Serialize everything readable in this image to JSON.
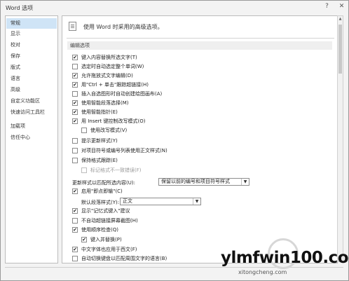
{
  "window": {
    "title": "Word 选项",
    "help_icon": "question-icon",
    "close_icon": "close-icon"
  },
  "sidebar": {
    "items": [
      {
        "label": "常规",
        "active": true
      },
      {
        "label": "显示",
        "active": false
      },
      {
        "label": "校对",
        "active": false
      },
      {
        "label": "保存",
        "active": false
      },
      {
        "label": "版式",
        "active": false
      },
      {
        "label": "语言",
        "active": false
      },
      {
        "label": "高级",
        "active": false
      },
      {
        "label": "自定义功能区",
        "active": false
      },
      {
        "label": "快速访问工具栏",
        "active": false
      },
      {
        "label": "加载项",
        "active": false
      },
      {
        "label": "信任中心",
        "active": false
      }
    ]
  },
  "header": {
    "text": "使用 Word 时采用的高级选项。"
  },
  "section": {
    "title": "编辑选项"
  },
  "options": [
    {
      "label": "键入内容替换所选文字(T)",
      "checked": true,
      "enabled": true
    },
    {
      "label": "选定时自动选定整个单词(W)",
      "checked": false,
      "enabled": true
    },
    {
      "label": "允许拖放式文字编辑(D)",
      "checked": true,
      "enabled": true
    },
    {
      "label": "用\"Ctrl + 单击\"跟踪超链接(H)",
      "checked": true,
      "enabled": true
    },
    {
      "label": "插入自选图形时自动创建绘图画布(A)",
      "checked": false,
      "enabled": true
    },
    {
      "label": "使用智能段落选择(M)",
      "checked": true,
      "enabled": true
    },
    {
      "label": "使用智能指针(E)",
      "checked": true,
      "enabled": true
    },
    {
      "label": "用 Insert 键控制改写模式(O)",
      "checked": true,
      "enabled": true
    },
    {
      "label": "使用改写模式(V)",
      "checked": false,
      "enabled": true
    },
    {
      "label": "提示更新样式(Y)",
      "checked": false,
      "enabled": true
    },
    {
      "label": "对项目符号或编号列表使用正文样式(N)",
      "checked": false,
      "enabled": true
    },
    {
      "label": "保持格式跟踪(E)",
      "checked": false,
      "enabled": true
    },
    {
      "label": "标记格式不一致错误(F)",
      "checked": false,
      "enabled": false
    }
  ],
  "paste_style": {
    "label": "更新样式以匹配所选内容(U):",
    "value": "保留以前的编号和项目符号样式"
  },
  "click_type": {
    "label": "启用\"即点即输\"(C)",
    "checked": true
  },
  "default_para": {
    "label": "默认段落样式(Y):",
    "value": "正文"
  },
  "options2": [
    {
      "label": "显示\"记忆式键入\"建议",
      "checked": true
    },
    {
      "label": "不自动超链接屏幕截图(H)",
      "checked": false
    },
    {
      "label": "使用顺序检查(Q)",
      "checked": true
    },
    {
      "label": "键入并替换(P)",
      "checked": true
    },
    {
      "label": "中文字体也应用于西文(F)",
      "checked": true
    },
    {
      "label": "自动切换键盘以匹配周围文字的语言(B)",
      "checked": false
    }
  ],
  "watermark": {
    "main": "ylmfwin100.com",
    "sub": "xitongcheng.com"
  }
}
